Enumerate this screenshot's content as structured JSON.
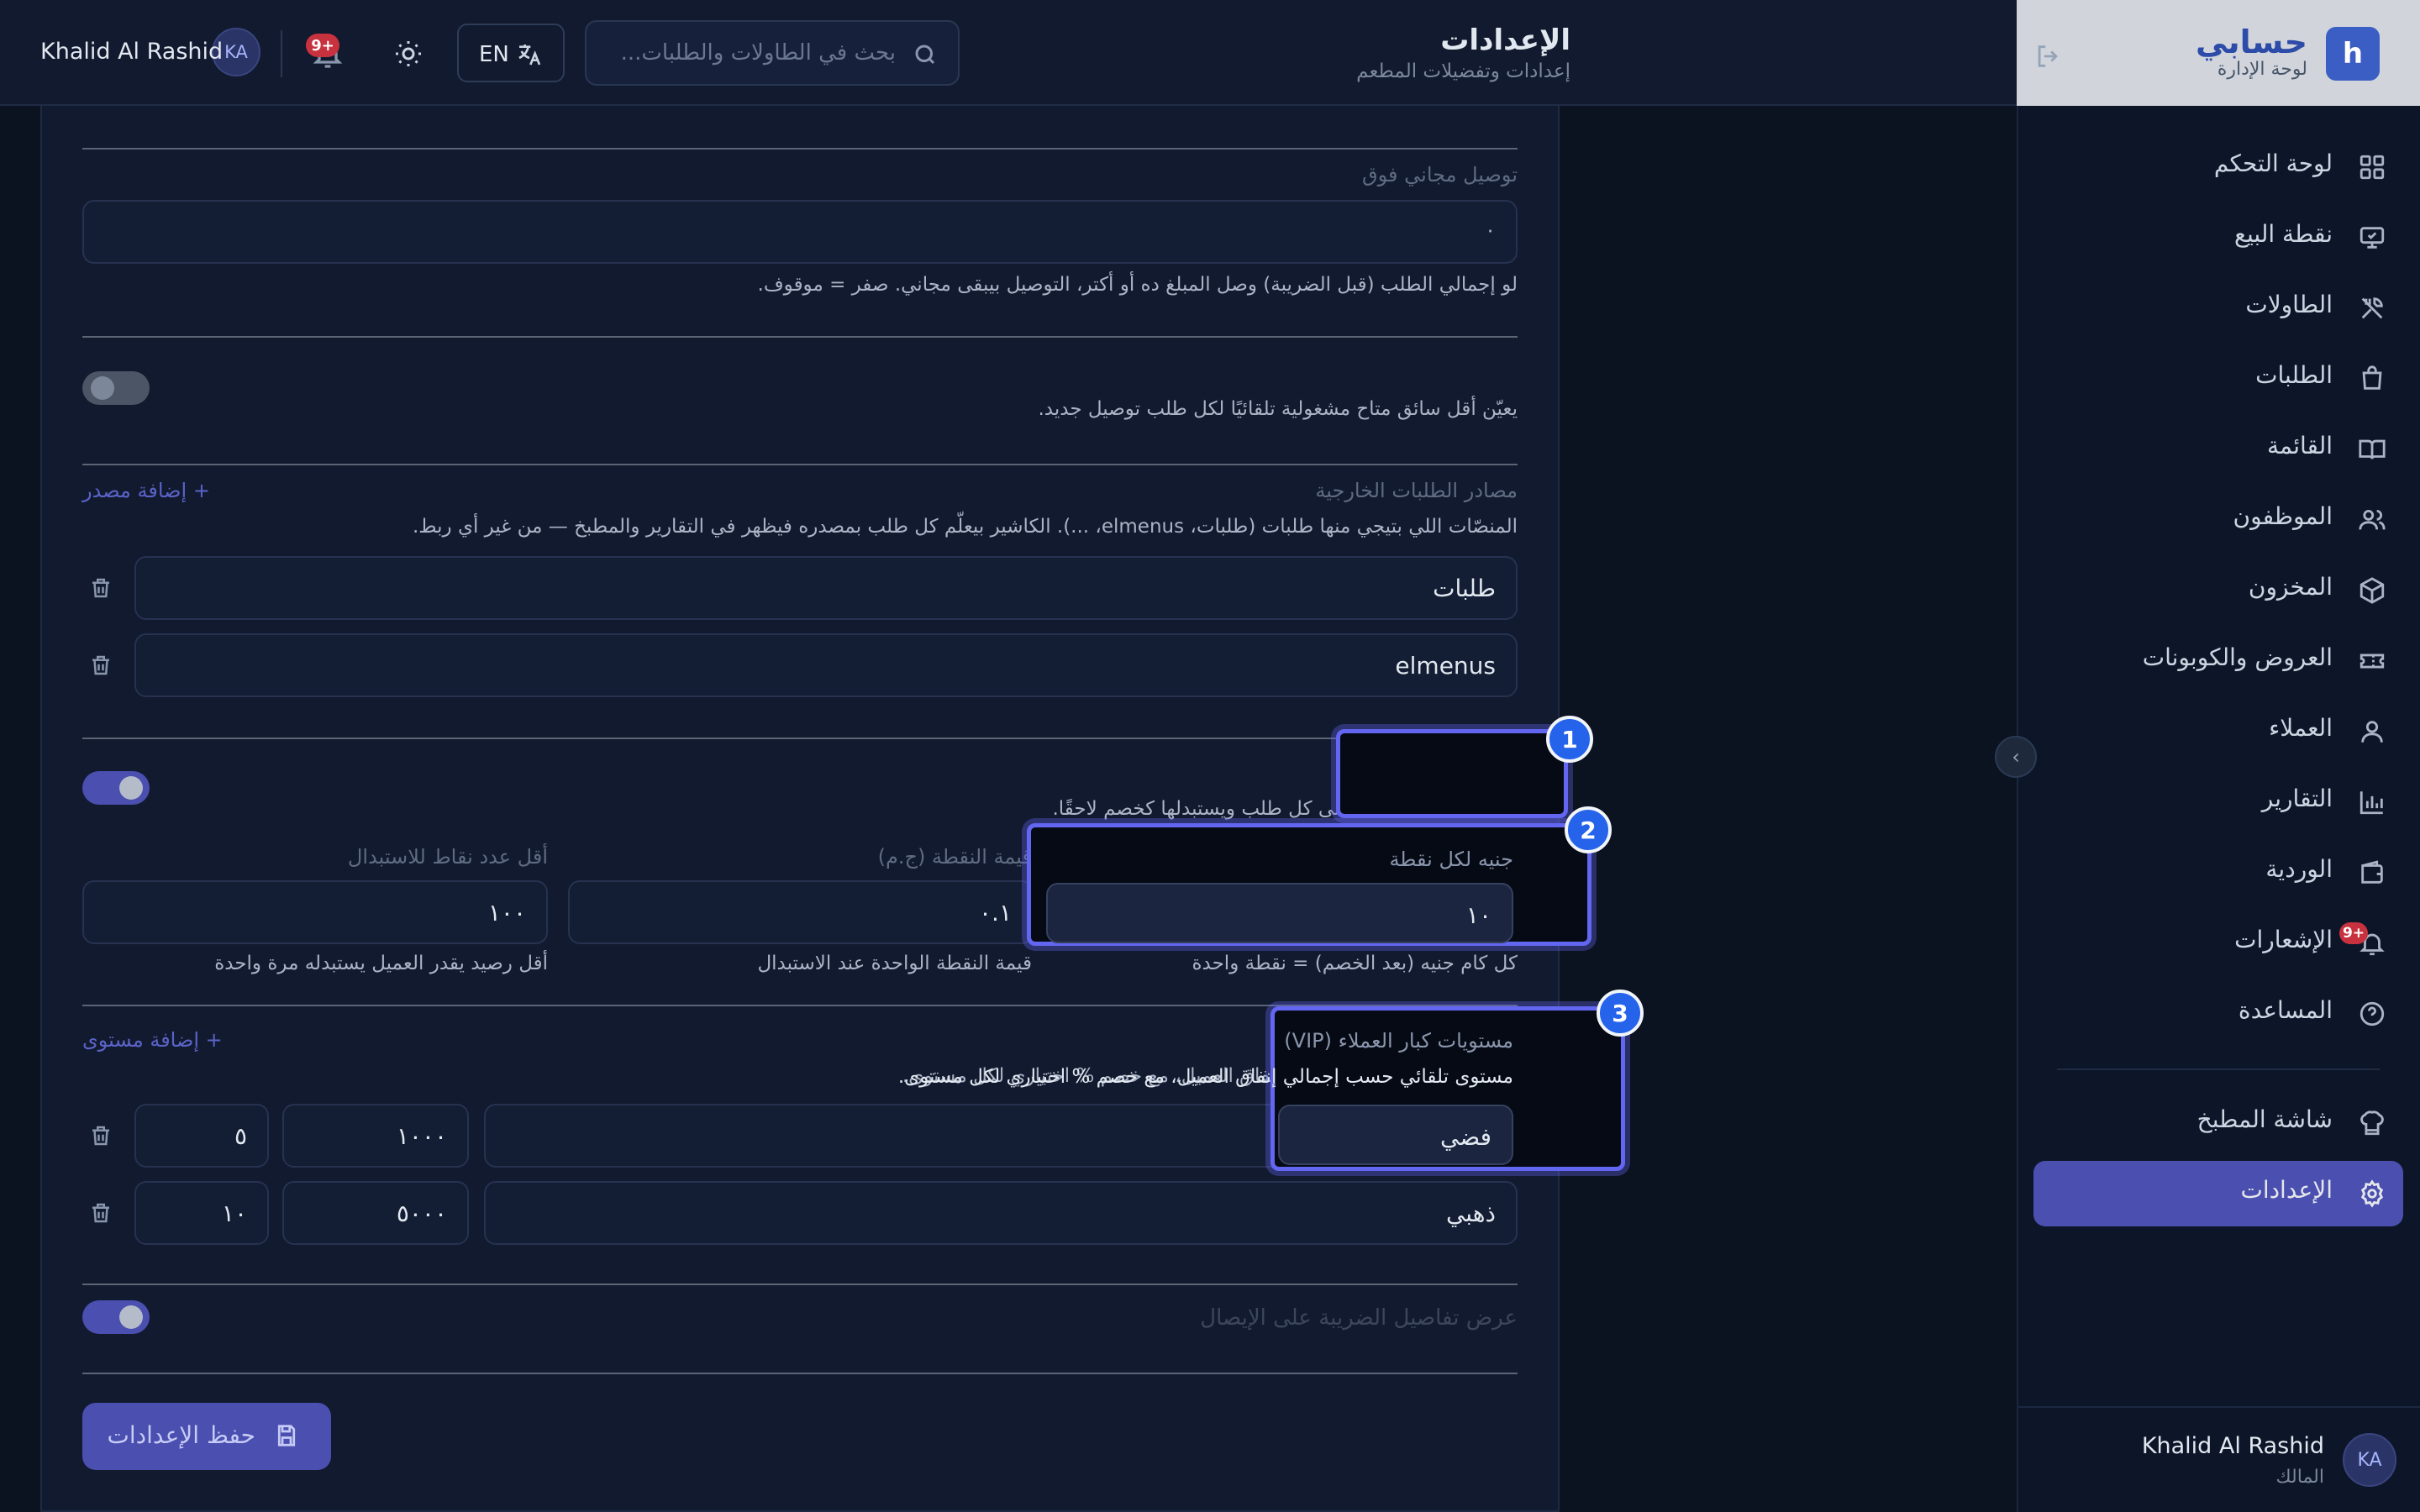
{
  "brand": {
    "logo_letter": "h",
    "name": "حسابي",
    "subtitle": "لوحة الإدارة"
  },
  "header": {
    "title": "الإعدادات",
    "subtitle": "إعدادات وتفضيلات المطعم",
    "search_placeholder": "بحث في الطاولات والطلبات...",
    "lang_label": "EN",
    "notif_badge": "+9",
    "user_name": "Khalid Al Rashid",
    "user_initials": "KA"
  },
  "sidebar": {
    "items": [
      {
        "label": "لوحة التحكم",
        "icon": "dashboard-icon"
      },
      {
        "label": "نقطة البيع",
        "icon": "monitor-icon"
      },
      {
        "label": "الطاولات",
        "icon": "utensils-icon"
      },
      {
        "label": "الطلبات",
        "icon": "bag-icon"
      },
      {
        "label": "القائمة",
        "icon": "book-icon"
      },
      {
        "label": "الموظفون",
        "icon": "users-icon"
      },
      {
        "label": "المخزون",
        "icon": "box-icon"
      },
      {
        "label": "العروض والكوبونات",
        "icon": "ticket-icon"
      },
      {
        "label": "العملاء",
        "icon": "user-icon"
      },
      {
        "label": "التقارير",
        "icon": "chart-icon"
      },
      {
        "label": "الوردية",
        "icon": "wallet-icon"
      },
      {
        "label": "الإشعارات",
        "icon": "bell-icon",
        "badge": "+9"
      },
      {
        "label": "المساعدة",
        "icon": "help-icon"
      }
    ],
    "kitchen_label": "شاشة المطبخ",
    "settings_label": "الإعدادات",
    "footer": {
      "name": "Khalid Al Rashid",
      "role": "المالك",
      "initials": "KA"
    }
  },
  "settings": {
    "free_delivery": {
      "label": "توصيل مجاني فوق",
      "value": "٠",
      "help": "لو إجمالي الطلب (قبل الضريبة) وصل المبلغ ده أو أكتر، التوصيل بيبقى مجاني. صفر = موقوف."
    },
    "auto_assign": {
      "enabled": false,
      "help": "يعيّن أقل سائق متاح مشغولية تلقائيًا لكل طلب توصيل جديد."
    },
    "external_sources": {
      "label": "مصادر الطلبات الخارجية",
      "add_label": "+ إضافة مصدر",
      "help": "المنصّات اللي بتيجي منها طلبات (طلبات، elmenus، ...). الكاشير بيعلّم كل طلب بمصدره فيظهر في التقارير والمطبخ — من غير أي ربط.",
      "items": [
        "طلبات",
        "elmenus"
      ]
    },
    "loyalty": {
      "enabled": true,
      "help": "يكسب العميل نقاطًا على كل طلب ويستبدلها كخصم لاحقًا.",
      "fields": [
        {
          "label": "جنيه لكل نقطة",
          "value": "١٠",
          "help": "كل كام جنيه (بعد الخصم) = نقطة واحدة"
        },
        {
          "label": "قيمة النقطة (ج.م)",
          "value": "٠.١",
          "help": "قيمة النقطة الواحدة عند الاستبدال"
        },
        {
          "label": "أقل عدد نقاط للاستبدال",
          "value": "١٠٠",
          "help": "أقل رصيد يقدر العميل يستبدله مرة واحدة"
        }
      ]
    },
    "vip": {
      "label": "مستويات كبار العملاء (VIP)",
      "add_label": "+ إضافة مستوى",
      "help": "مستوى تلقائي حسب إجمالي إنفاق العميل، مع خصم % اختياري لكل مستوى.",
      "tiers": [
        {
          "name": "فضي",
          "min_spend": "١٠٠٠",
          "discount": "٥"
        },
        {
          "name": "ذهبي",
          "min_spend": "٥٠٠٠",
          "discount": "١٠"
        }
      ]
    },
    "tax_receipt": {
      "enabled": true,
      "label": "عرض تفاصيل الضريبة على الإيصال"
    },
    "save_label": "حفظ الإعدادات"
  },
  "highlights": [
    "1",
    "2",
    "3"
  ]
}
